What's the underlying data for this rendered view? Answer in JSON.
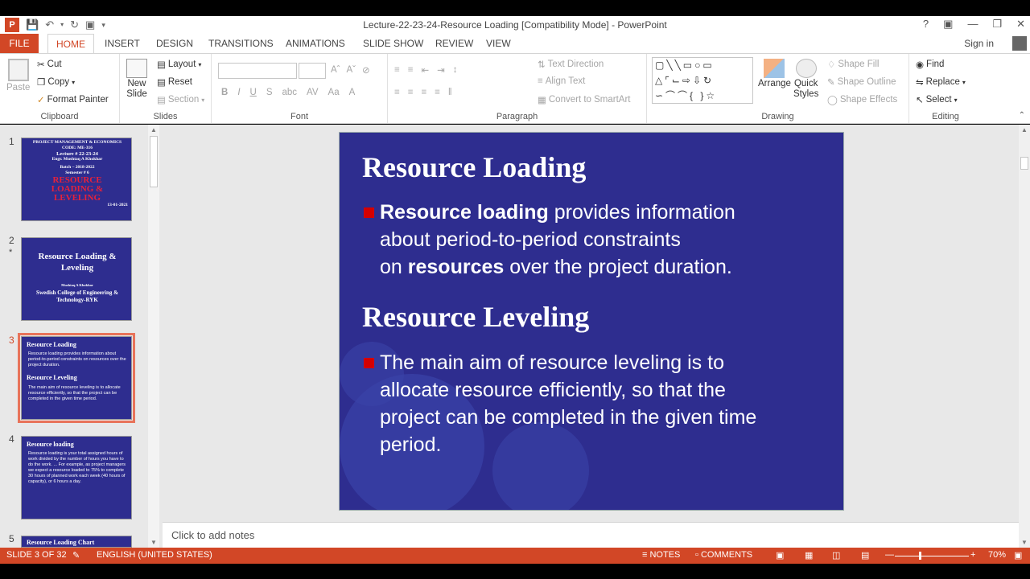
{
  "window": {
    "title": "Lecture-22-23-24-Resource Loading [Compatibility Mode] - PowerPoint",
    "help": "?",
    "sign_in": "Sign in"
  },
  "tabs": [
    {
      "label": "FILE"
    },
    {
      "label": "HOME"
    },
    {
      "label": "INSERT"
    },
    {
      "label": "DESIGN"
    },
    {
      "label": "TRANSITIONS"
    },
    {
      "label": "ANIMATIONS"
    },
    {
      "label": "SLIDE SHOW"
    },
    {
      "label": "REVIEW"
    },
    {
      "label": "VIEW"
    }
  ],
  "ribbon": {
    "clipboard": {
      "label": "Clipboard",
      "paste": "Paste",
      "cut": "Cut",
      "copy": "Copy",
      "format_painter": "Format Painter"
    },
    "slides": {
      "label": "Slides",
      "new_slide_1": "New",
      "new_slide_2": "Slide",
      "layout": "Layout",
      "reset": "Reset",
      "section": "Section"
    },
    "font": {
      "label": "Font"
    },
    "paragraph": {
      "label": "Paragraph",
      "text_direction": "Text Direction",
      "align_text": "Align Text",
      "convert_smartart": "Convert to SmartArt"
    },
    "drawing": {
      "label": "Drawing",
      "arrange": "Arrange",
      "quick_styles_1": "Quick",
      "quick_styles_2": "Styles",
      "shape_fill": "Shape Fill",
      "shape_outline": "Shape Outline",
      "shape_effects": "Shape Effects"
    },
    "editing": {
      "label": "Editing",
      "find": "Find",
      "replace": "Replace",
      "select": "Select"
    }
  },
  "thumbnails": [
    {
      "num": "1",
      "lines": [
        "PROJECT MANAGEMENT & ECONOMICS",
        "CODE: ME-316",
        "Lecture # 22-23-24",
        "Engr. Mushtaq A Khokhar",
        "Batch – 2018-2022",
        "Semester # 6",
        "RESOURCE",
        "LOADING &",
        "LEVELING",
        "13-01-2021"
      ]
    },
    {
      "num": "2",
      "star": "*",
      "title": "Resource Loading & Leveling",
      "sub1": "Mushtaq A Khokhar",
      "sub2": "Swedish College of Engineering & Technology-RYK"
    },
    {
      "num": "3",
      "h1": "Resource Loading",
      "b1": "Resource loading provides information about period-to-period constraints on resources over the project duration.",
      "h2": "Resource Leveling",
      "b2": "The main aim of resource leveling is to allocate resource efficiently, so that the project can be completed in the given time period."
    },
    {
      "num": "4",
      "h1": "Resource loading",
      "b1": "Resource loading is your total assigned hours of work divided by the number of hours you have to do the work. ... For example, as project managers we expect a resource loaded to 75% to complete 30 hours of planned work each week (40 hours of capacity), or 6 hours a day."
    },
    {
      "num": "5",
      "h1": "Resource Loading Chart"
    }
  ],
  "slide": {
    "heading1": "Resource Loading",
    "bullet1_bold": "Resource loading",
    "bullet1_rest1": " provides information",
    "bullet1_line2": "about period-to-period constraints",
    "bullet1_line3a": "on ",
    "bullet1_bold2": "resources",
    "bullet1_line3b": " over the project duration.",
    "heading2": "Resource Leveling",
    "bullet2_line1": "The main aim of resource leveling is to",
    "bullet2_line2": "allocate resource efficiently, so that the",
    "bullet2_line3": "project can be completed in the given time",
    "bullet2_line4": "period."
  },
  "notes_placeholder": "Click to add notes",
  "status": {
    "slide": "SLIDE 3 OF 32",
    "language": "ENGLISH (UNITED STATES)",
    "notes": "NOTES",
    "comments": "COMMENTS",
    "zoom": "70%",
    "zoom_level": 0.7
  },
  "colors": {
    "accent": "#d24726",
    "slide_bg": "#2e2d8f",
    "bullet": "#d40000"
  }
}
